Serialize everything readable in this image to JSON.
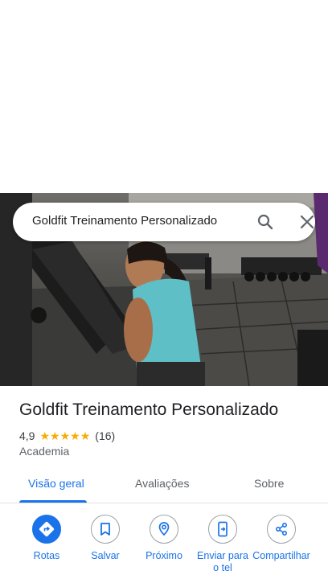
{
  "search": {
    "query": "Goldfit Treinamento Personalizado",
    "icons": {
      "search": "search-icon",
      "close": "close-icon"
    }
  },
  "place": {
    "name": "Goldfit Treinamento Personalizado",
    "rating": "4,9",
    "stars": 5,
    "review_count": "(16)",
    "category": "Academia"
  },
  "tabs": [
    {
      "label": "Visão geral",
      "active": true
    },
    {
      "label": "Avaliações",
      "active": false
    },
    {
      "label": "Sobre",
      "active": false
    }
  ],
  "actions": [
    {
      "label": "Rotas",
      "icon": "directions-icon"
    },
    {
      "label": "Salvar",
      "icon": "bookmark-icon"
    },
    {
      "label": "Próximo",
      "icon": "nearby-icon"
    },
    {
      "label": "Enviar para o tel",
      "icon": "send-to-phone-icon"
    },
    {
      "label": "Compartilhar",
      "icon": "share-icon"
    }
  ],
  "colors": {
    "accent": "#1a73e8",
    "star": "#f9ab00",
    "text": "#202124",
    "muted": "#5f6368"
  }
}
